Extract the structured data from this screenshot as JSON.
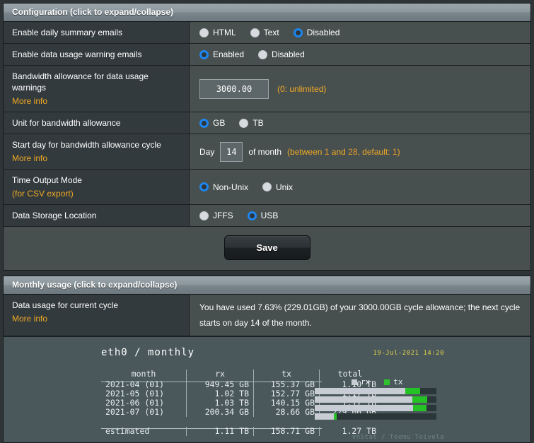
{
  "config_panel": {
    "header": "Configuration (click to expand/collapse)",
    "rows": {
      "daily_summary": {
        "label": "Enable daily summary emails",
        "options": [
          "HTML",
          "Text",
          "Disabled"
        ],
        "selected": "Disabled"
      },
      "warning_emails": {
        "label": "Enable data usage warning emails",
        "options": [
          "Enabled",
          "Disabled"
        ],
        "selected": "Enabled"
      },
      "bandwidth_allowance": {
        "label": "Bandwidth allowance for data usage warnings",
        "more_info": "More info",
        "value": "3000.00",
        "hint": "(0: unlimited)"
      },
      "unit": {
        "label": "Unit for bandwidth allowance",
        "options": [
          "GB",
          "TB"
        ],
        "selected": "GB"
      },
      "start_day": {
        "label": "Start day for bandwidth allowance cycle",
        "more_info": "More info",
        "prefix": "Day",
        "value": "14",
        "suffix": "of month",
        "hint_open": "(between ",
        "hint_n1": "1",
        "hint_mid": " and ",
        "hint_n2": "28",
        "hint_mid2": ", default: ",
        "hint_n3": "1",
        "hint_close": ")"
      },
      "time_mode": {
        "label": "Time Output Mode",
        "sub_label": "(for CSV export)",
        "options": [
          "Non-Unix",
          "Unix"
        ],
        "selected": "Non-Unix"
      },
      "storage": {
        "label": "Data Storage Location",
        "options": [
          "JFFS",
          "USB"
        ],
        "selected": "USB"
      }
    },
    "save_label": "Save"
  },
  "monthly_panel": {
    "header": "Monthly usage (click to expand/collapse)",
    "usage_row": {
      "label": "Data usage for current cycle",
      "more_info": "More info",
      "text": "You have used 7.63% (229.01GB) of your 3000.00GB cycle allowance; the next cycle starts on day 14 of the month."
    }
  },
  "colors": {
    "accent_orange": "#f0a924",
    "radio_blue": "#1e86f0",
    "bar_rx": "#c8ccd4",
    "bar_tx": "#25c225",
    "chart_bg": "#4a585c",
    "date_yellow": "#e0d14a"
  },
  "chart_data": {
    "type": "table",
    "title": "eth0 / monthly",
    "timestamp": "19-Jul-2021 14:20",
    "credit": "vnStat / Teemu Toivola",
    "columns": [
      "month",
      "rx",
      "tx",
      "total"
    ],
    "legend": [
      "rx",
      "tx"
    ],
    "legend_position": "top-right",
    "rows": [
      {
        "month": "2021-04 (01)",
        "rx": "949.45 GB",
        "tx": "155.37 GB",
        "total": "1.10 TB",
        "rx_gb": 949.45,
        "tx_gb": 155.37,
        "total_gb": 1100,
        "rx_frac": 0.745,
        "tx_frac": 0.122
      },
      {
        "month": "2021-05 (01)",
        "rx": "1.02 TB",
        "tx": "152.77 GB",
        "total": "1.17 TB",
        "rx_gb": 1020,
        "tx_gb": 152.77,
        "total_gb": 1170,
        "rx_frac": 0.8,
        "tx_frac": 0.12
      },
      {
        "month": "2021-06 (01)",
        "rx": "1.03 TB",
        "tx": "140.15 GB",
        "total": "1.17 TB",
        "rx_gb": 1030,
        "tx_gb": 140.15,
        "total_gb": 1170,
        "rx_frac": 0.808,
        "tx_frac": 0.11
      },
      {
        "month": "2021-07 (01)",
        "rx": "200.34 GB",
        "tx": "28.66 GB",
        "total": "229.00 GB",
        "rx_gb": 200.34,
        "tx_gb": 28.66,
        "total_gb": 229,
        "rx_frac": 0.157,
        "tx_frac": 0.022
      }
    ],
    "estimated": {
      "month": "estimated",
      "rx": "1.11 TB",
      "tx": "158.71 GB",
      "total": "1.27 TB"
    },
    "bar_max_gb": 1275,
    "ylabel": "",
    "xlabel": ""
  }
}
